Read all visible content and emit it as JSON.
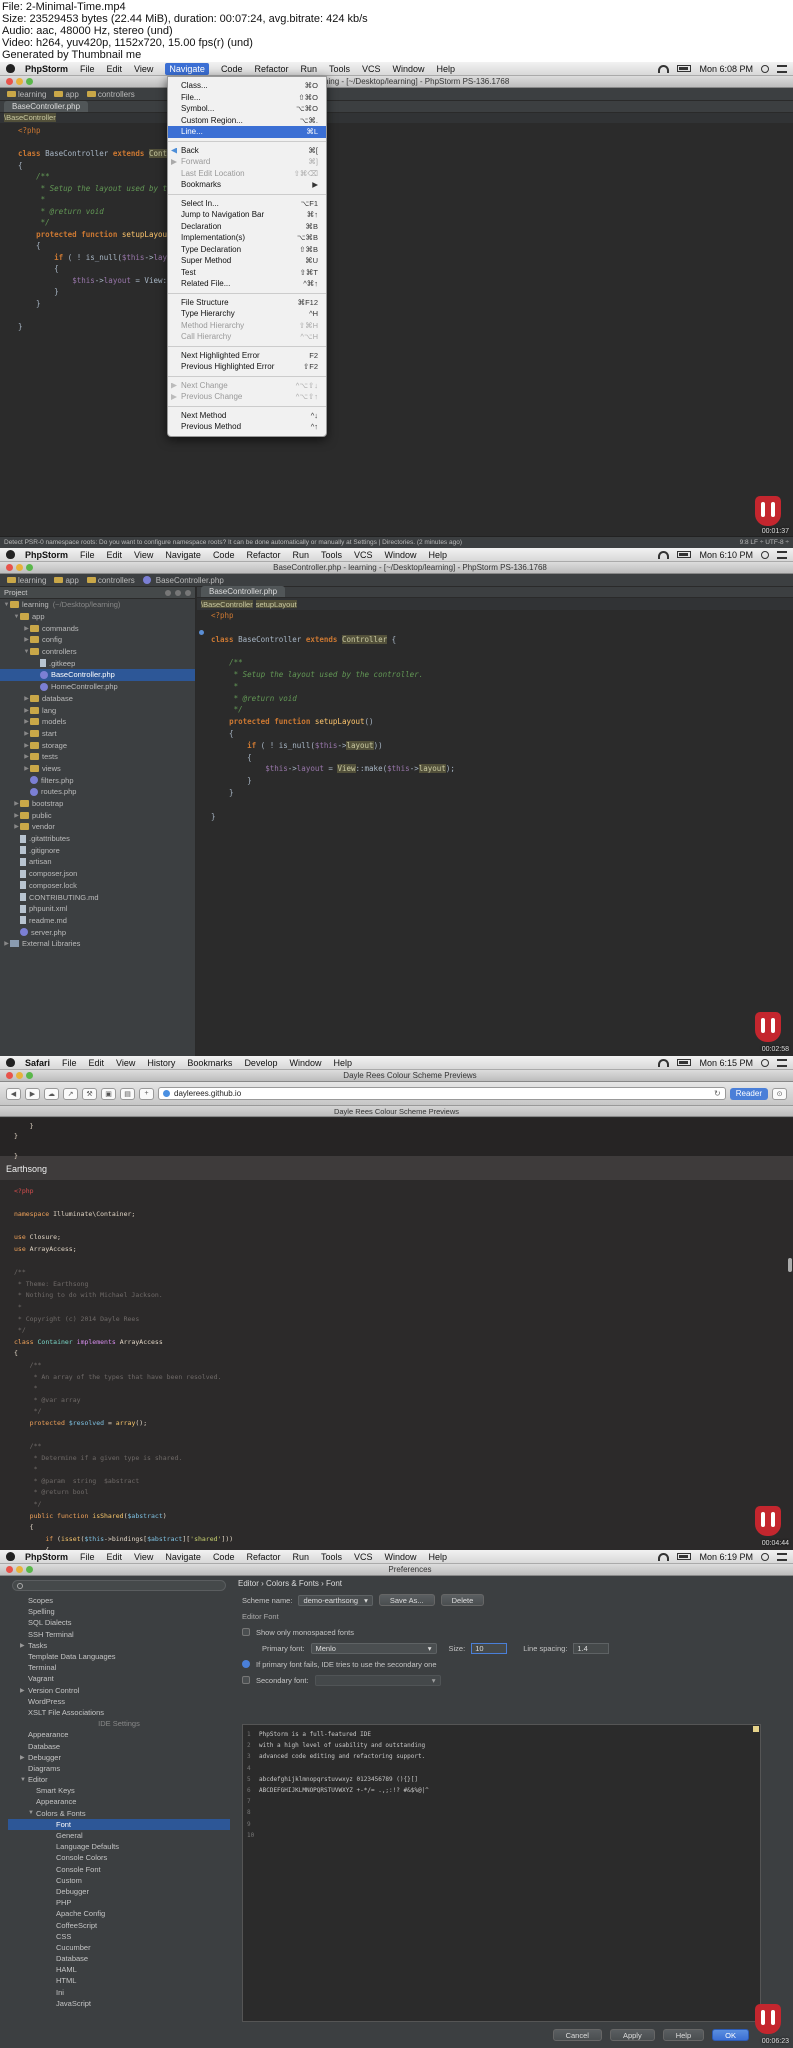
{
  "header": {
    "file": "File: 2-Minimal-Time.mp4",
    "size": "Size: 23529453 bytes (22.44 MiB), duration: 00:07:24, avg.bitrate: 424 kb/s",
    "audio": "Audio: aac, 48000 Hz, stereo (und)",
    "video": "Video: h264, yuv420p, 1152x720, 15.00 fps(r) (und)",
    "generated": "Generated by Thumbnail me"
  },
  "ide_menubar": {
    "app": "PhpStorm",
    "items": [
      "File",
      "Edit",
      "View",
      "Navigate",
      "Code",
      "Refactor",
      "Run",
      "Tools",
      "VCS",
      "Window",
      "Help"
    ]
  },
  "frame1": {
    "clock": "Mon 6:08 PM",
    "window_title": "learning - [~/Desktop/learning] - PhpStorm PS-136.1768",
    "breadcrumbs": [
      "learning",
      "app",
      "controllers"
    ],
    "tab": "BaseController.php",
    "class_crumb": "\\BaseController",
    "status_msg": "Detect PSR-0 namespace roots: Do you want to configure namespace roots? It can be done automatically or manually at Settings | Directories. (2 minutes ago)",
    "status_pos": "9:8   LF ÷   UTF-8 ÷",
    "timestamp": "00:01:37",
    "menu": [
      {
        "label": "Class...",
        "shortcut": "⌘O"
      },
      {
        "label": "File...",
        "shortcut": "⇧⌘O"
      },
      {
        "label": "Symbol...",
        "shortcut": "⌥⌘O"
      },
      {
        "label": "Custom Region...",
        "shortcut": "⌥⌘."
      },
      {
        "label": "Line...",
        "shortcut": "⌘L",
        "selected": true
      },
      {
        "sep": true
      },
      {
        "label": "Back",
        "shortcut": "⌘[",
        "icon": "back"
      },
      {
        "label": "Forward",
        "shortcut": "⌘]",
        "disabled": true,
        "icon": "fwd"
      },
      {
        "label": "Last Edit Location",
        "shortcut": "⇧⌘⌫",
        "disabled": true
      },
      {
        "label": "Bookmarks",
        "shortcut": "▶"
      },
      {
        "sep": true
      },
      {
        "label": "Select In...",
        "shortcut": "⌥F1"
      },
      {
        "label": "Jump to Navigation Bar",
        "shortcut": "⌘↑"
      },
      {
        "label": "Declaration",
        "shortcut": "⌘B"
      },
      {
        "label": "Implementation(s)",
        "shortcut": "⌥⌘B"
      },
      {
        "label": "Type Declaration",
        "shortcut": "⇧⌘B"
      },
      {
        "label": "Super Method",
        "shortcut": "⌘U"
      },
      {
        "label": "Test",
        "shortcut": "⇧⌘T"
      },
      {
        "label": "Related File...",
        "shortcut": "^⌘↑"
      },
      {
        "sep": true
      },
      {
        "label": "File Structure",
        "shortcut": "⌘F12"
      },
      {
        "label": "Type Hierarchy",
        "shortcut": "^H"
      },
      {
        "label": "Method Hierarchy",
        "shortcut": "⇧⌘H",
        "disabled": true
      },
      {
        "label": "Call Hierarchy",
        "shortcut": "^⌥H",
        "disabled": true
      },
      {
        "sep": true
      },
      {
        "label": "Next Highlighted Error",
        "shortcut": "F2"
      },
      {
        "label": "Previous Highlighted Error",
        "shortcut": "⇧F2"
      },
      {
        "sep": true
      },
      {
        "label": "Next Change",
        "shortcut": "^⌥⇧↓",
        "disabled": true,
        "icon": "chg"
      },
      {
        "label": "Previous Change",
        "shortcut": "^⌥⇧↑",
        "disabled": true,
        "icon": "chg"
      },
      {
        "sep": true
      },
      {
        "label": "Next Method",
        "shortcut": "^↓"
      },
      {
        "label": "Previous Method",
        "shortcut": "^↑"
      }
    ]
  },
  "frame2": {
    "clock": "Mon 6:10 PM",
    "window_title": "BaseController.php - learning - [~/Desktop/learning] - PhpStorm PS-136.1768",
    "breadcrumbs": [
      "learning",
      "app",
      "controllers",
      "BaseController.php"
    ],
    "tab": "BaseController.php",
    "crumbs": [
      "\\BaseController",
      "setupLayout"
    ],
    "project_label": "Project",
    "timestamp": "00:02:58",
    "tree": [
      {
        "label": "learning",
        "extra": "(~/Desktop/learning)",
        "depth": 0,
        "type": "folder",
        "open": true
      },
      {
        "label": "app",
        "depth": 1,
        "type": "folder",
        "open": true
      },
      {
        "label": "commands",
        "depth": 2,
        "type": "folder"
      },
      {
        "label": "config",
        "depth": 2,
        "type": "folder"
      },
      {
        "label": "controllers",
        "depth": 2,
        "type": "folder",
        "open": true
      },
      {
        "label": ".gitkeep",
        "depth": 3,
        "type": "file"
      },
      {
        "label": "BaseController.php",
        "depth": 3,
        "type": "php",
        "selected": true
      },
      {
        "label": "HomeController.php",
        "depth": 3,
        "type": "php"
      },
      {
        "label": "database",
        "depth": 2,
        "type": "folder"
      },
      {
        "label": "lang",
        "depth": 2,
        "type": "folder"
      },
      {
        "label": "models",
        "depth": 2,
        "type": "folder"
      },
      {
        "label": "start",
        "depth": 2,
        "type": "folder"
      },
      {
        "label": "storage",
        "depth": 2,
        "type": "folder"
      },
      {
        "label": "tests",
        "depth": 2,
        "type": "folder"
      },
      {
        "label": "views",
        "depth": 2,
        "type": "folder"
      },
      {
        "label": "filters.php",
        "depth": 2,
        "type": "php"
      },
      {
        "label": "routes.php",
        "depth": 2,
        "type": "php"
      },
      {
        "label": "bootstrap",
        "depth": 1,
        "type": "folder"
      },
      {
        "label": "public",
        "depth": 1,
        "type": "folder"
      },
      {
        "label": "vendor",
        "depth": 1,
        "type": "folder"
      },
      {
        "label": ".gitattributes",
        "depth": 1,
        "type": "file"
      },
      {
        "label": ".gitignore",
        "depth": 1,
        "type": "file"
      },
      {
        "label": "artisan",
        "depth": 1,
        "type": "file"
      },
      {
        "label": "composer.json",
        "depth": 1,
        "type": "file"
      },
      {
        "label": "composer.lock",
        "depth": 1,
        "type": "file"
      },
      {
        "label": "CONTRIBUTING.md",
        "depth": 1,
        "type": "file"
      },
      {
        "label": "phpunit.xml",
        "depth": 1,
        "type": "file"
      },
      {
        "label": "readme.md",
        "depth": 1,
        "type": "file"
      },
      {
        "label": "server.php",
        "depth": 1,
        "type": "php"
      },
      {
        "label": "External Libraries",
        "depth": 0,
        "type": "lib"
      }
    ]
  },
  "frame3": {
    "menubar": {
      "app": "Safari",
      "items": [
        "File",
        "Edit",
        "View",
        "History",
        "Bookmarks",
        "Develop",
        "Window",
        "Help"
      ],
      "clock": "Mon 6:15 PM"
    },
    "window_title": "Dayle Rees Colour Scheme Previews",
    "url": "daylerees.github.io",
    "reader": "Reader",
    "tab_title": "Dayle Rees Colour Scheme Previews",
    "scheme": "Earthsong",
    "timestamp": "00:04:44"
  },
  "frame4": {
    "clock": "Mon 6:19 PM",
    "window_title": "Preferences",
    "path": "Editor › Colors & Fonts › Font",
    "scheme_label": "Scheme name:",
    "scheme_value": "demo-earthsong",
    "save_as": "Save As...",
    "delete": "Delete",
    "editor_font": "Editor Font",
    "show_mono": "Show only monospaced fonts",
    "primary_font_label": "Primary font:",
    "primary_font": "Menlo",
    "size_label": "Size:",
    "size": "10",
    "spacing_label": "Line spacing:",
    "spacing": "1.4",
    "info": "If primary font fails, IDE tries to use the secondary one",
    "secondary_label": "Secondary font:",
    "preview": [
      "PhpStorm is a full-featured IDE",
      "with a high level of usability and outstanding",
      "advanced code editing and refactoring support.",
      "",
      "abcdefghijklmnopqrstuvwxyz 0123456789 (){}[]",
      "ABCDEFGHIJKLMNOPQRSTUVWXYZ +-*/= .,;:!? #&$%@|^",
      "",
      "",
      "",
      ""
    ],
    "sidebar": [
      {
        "label": "Scopes",
        "lvl": 0
      },
      {
        "label": "Spelling",
        "lvl": 0
      },
      {
        "label": "SQL Dialects",
        "lvl": 0
      },
      {
        "label": "SSH Terminal",
        "lvl": 0
      },
      {
        "label": "Tasks",
        "lvl": 0,
        "tri": "▶"
      },
      {
        "label": "Template Data Languages",
        "lvl": 0
      },
      {
        "label": "Terminal",
        "lvl": 0
      },
      {
        "label": "Vagrant",
        "lvl": 0
      },
      {
        "label": "Version Control",
        "lvl": 0,
        "tri": "▶"
      },
      {
        "label": "WordPress",
        "lvl": 0
      },
      {
        "label": "XSLT File Associations",
        "lvl": 0
      },
      {
        "label": "IDE Settings",
        "center": true
      },
      {
        "label": "Appearance",
        "lvl": 0
      },
      {
        "label": "Database",
        "lvl": 0
      },
      {
        "label": "Debugger",
        "lvl": 0,
        "tri": "▶"
      },
      {
        "label": "Diagrams",
        "lvl": 0
      },
      {
        "label": "Editor",
        "lvl": 0,
        "tri": "▼"
      },
      {
        "label": "Smart Keys",
        "lvl": 1
      },
      {
        "label": "Appearance",
        "lvl": 1
      },
      {
        "label": "Colors & Fonts",
        "lvl": 1,
        "tri": "▼"
      },
      {
        "label": "Font",
        "lvl": 3,
        "selected": true
      },
      {
        "label": "General",
        "lvl": 3
      },
      {
        "label": "Language Defaults",
        "lvl": 3
      },
      {
        "label": "Console Colors",
        "lvl": 3
      },
      {
        "label": "Console Font",
        "lvl": 3
      },
      {
        "label": "Custom",
        "lvl": 3
      },
      {
        "label": "Debugger",
        "lvl": 3
      },
      {
        "label": "PHP",
        "lvl": 3
      },
      {
        "label": "Apache Config",
        "lvl": 3
      },
      {
        "label": "CoffeeScript",
        "lvl": 3
      },
      {
        "label": "CSS",
        "lvl": 3
      },
      {
        "label": "Cucumber",
        "lvl": 3
      },
      {
        "label": "Database",
        "lvl": 3
      },
      {
        "label": "HAML",
        "lvl": 3
      },
      {
        "label": "HTML",
        "lvl": 3
      },
      {
        "label": "Ini",
        "lvl": 3
      },
      {
        "label": "JavaScript",
        "lvl": 3
      }
    ],
    "buttons": [
      "Cancel",
      "Apply",
      "Help",
      "OK"
    ],
    "timestamp": "00:06:23"
  }
}
